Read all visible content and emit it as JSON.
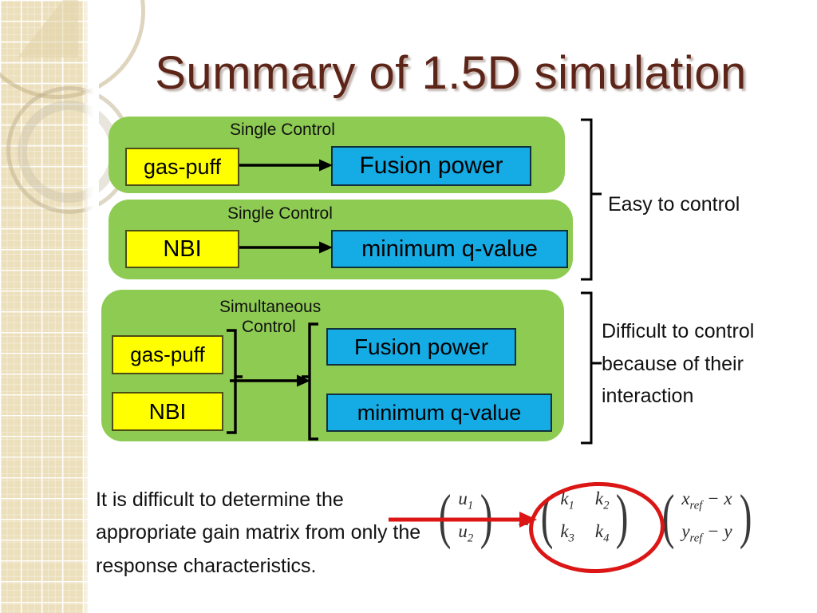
{
  "slide": {
    "title": "Summary of 1.5D simulation",
    "title_color": "#5d2418",
    "background_color": "#ffffff",
    "panel_color": "#8ecb52",
    "input_box_color": "#ffff00",
    "output_box_color": "#15abe4",
    "highlight_color": "#dc1515"
  },
  "panels": [
    {
      "caption": "Single Control",
      "inputs": [
        "gas-puff"
      ],
      "outputs": [
        "Fusion power"
      ]
    },
    {
      "caption": "Single Control",
      "inputs": [
        "NBI"
      ],
      "outputs": [
        "minimum q-value"
      ]
    },
    {
      "caption_line1": "Simultaneous",
      "caption_line2": "Control",
      "inputs": [
        "gas-puff",
        "NBI"
      ],
      "outputs": [
        "Fusion power",
        "minimum q-value"
      ]
    }
  ],
  "annotations": {
    "easy": "Easy to control",
    "hard": "Difficult to control because of their interaction"
  },
  "bottom_text": "It is difficult to determine the appropriate gain matrix from only the response characteristics.",
  "equation": {
    "equals": "=",
    "u_vector": [
      [
        "u<sub>1</sub>"
      ],
      [
        "u<sub>2</sub>"
      ]
    ],
    "u_cells": [
      "u1",
      "u2"
    ],
    "k_matrix_rows": [
      [
        "k1",
        "k2"
      ],
      [
        "k3",
        "k4"
      ]
    ],
    "error_vector": [
      "xref - x",
      "yref - y"
    ],
    "u1": "u",
    "u1_sub": "1",
    "u2": "u",
    "u2_sub": "2",
    "k1": "k",
    "k1_sub": "1",
    "k2": "k",
    "k2_sub": "2",
    "k3": "k",
    "k3_sub": "3",
    "k4": "k",
    "k4_sub": "4",
    "e1_a": "x",
    "e1_sub": "ref",
    "e1_b": "− x",
    "e2_a": "y",
    "e2_sub": "ref",
    "e2_b": "− y",
    "paren_left": "(",
    "paren_right": ")"
  }
}
